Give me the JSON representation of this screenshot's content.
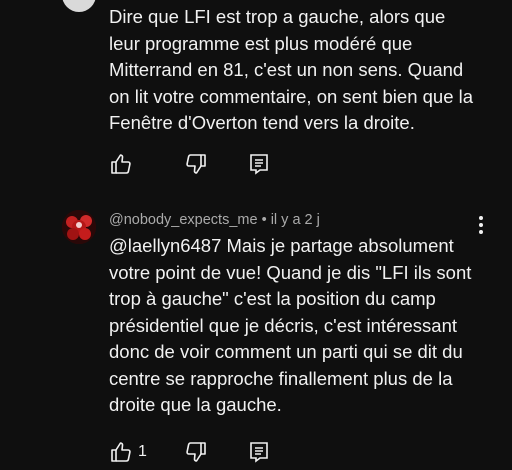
{
  "comment1": {
    "text": "Dire que LFI est trop a gauche, alors que\nleur programme est plus modéré que\nMitterrand en 81, c'est un non sens. Quand\non lit votre commentaire, on sent bien que la\nFenêtre d'Overton tend vers la droite."
  },
  "comment2": {
    "author": "@nobody_expects_me",
    "separator": " • ",
    "time": "il y a 2 j",
    "text": "@laellyn6487  Mais je partage absolument\nvotre point de vue! Quand je dis \"LFI ils sont\ntrop à gauche\" c'est la position du camp\nprésidentiel que je décris, c'est intéressant\ndonc de voir comment un parti qui se dit du\ncentre se rapproche finallement plus de la\ndroite que la gauche.",
    "like_count": "1"
  },
  "icons": {
    "like": "thumb-up-icon",
    "dislike": "thumb-down-icon",
    "reply": "reply-icon",
    "more": "more-vert-icon"
  }
}
